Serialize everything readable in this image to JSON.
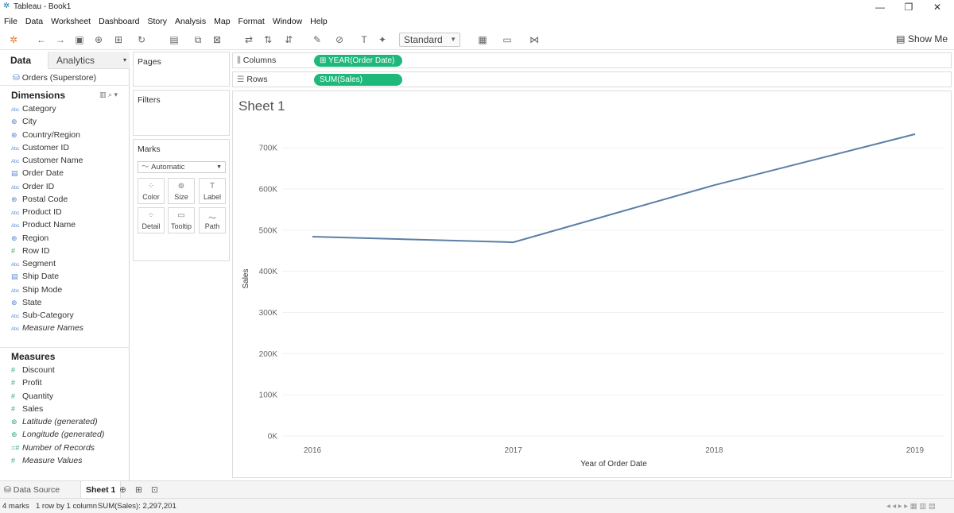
{
  "window": {
    "title": "Tableau - Book1"
  },
  "menu": [
    "File",
    "Data",
    "Worksheet",
    "Dashboard",
    "Story",
    "Analysis",
    "Map",
    "Format",
    "Window",
    "Help"
  ],
  "toolbar": {
    "view_mode": "Standard",
    "show_me": "Show Me"
  },
  "left_pane": {
    "tabs": {
      "data": "Data",
      "analytics": "Analytics"
    },
    "datasource": "Orders (Superstore)",
    "dimensions_header": "Dimensions",
    "dimensions": [
      {
        "icon": "Abc",
        "name": "Category"
      },
      {
        "icon": "globe",
        "name": "City"
      },
      {
        "icon": "globe",
        "name": "Country/Region"
      },
      {
        "icon": "Abc",
        "name": "Customer ID"
      },
      {
        "icon": "Abc",
        "name": "Customer Name"
      },
      {
        "icon": "date",
        "name": "Order Date"
      },
      {
        "icon": "Abc",
        "name": "Order ID"
      },
      {
        "icon": "globe",
        "name": "Postal Code"
      },
      {
        "icon": "Abc",
        "name": "Product ID"
      },
      {
        "icon": "Abc",
        "name": "Product Name"
      },
      {
        "icon": "globe",
        "name": "Region"
      },
      {
        "icon": "#",
        "name": "Row ID"
      },
      {
        "icon": "Abc",
        "name": "Segment"
      },
      {
        "icon": "date",
        "name": "Ship Date"
      },
      {
        "icon": "Abc",
        "name": "Ship Mode"
      },
      {
        "icon": "globe",
        "name": "State"
      },
      {
        "icon": "Abc",
        "name": "Sub-Category"
      },
      {
        "icon": "Abc",
        "name": "Measure Names"
      }
    ],
    "measures_header": "Measures",
    "measures": [
      {
        "icon": "#",
        "name": "Discount"
      },
      {
        "icon": "#",
        "name": "Profit"
      },
      {
        "icon": "#",
        "name": "Quantity"
      },
      {
        "icon": "#",
        "name": "Sales"
      },
      {
        "icon": "globe",
        "name": "Latitude (generated)"
      },
      {
        "icon": "globe",
        "name": "Longitude (generated)"
      },
      {
        "icon": "=#",
        "name": "Number of Records"
      },
      {
        "icon": "#",
        "name": "Measure Values"
      }
    ]
  },
  "cards": {
    "pages": "Pages",
    "filters": "Filters",
    "marks": "Marks",
    "mark_type": "Automatic",
    "mark_buttons": [
      "Color",
      "Size",
      "Label",
      "Detail",
      "Tooltip",
      "Path"
    ]
  },
  "shelves": {
    "columns_label": "Columns",
    "columns_pill": "YEAR(Order Date)",
    "rows_label": "Rows",
    "rows_pill": "SUM(Sales)"
  },
  "sheet_title": "Sheet 1",
  "chart_data": {
    "type": "line",
    "x": [
      "2016",
      "2017",
      "2018",
      "2019"
    ],
    "series": [
      {
        "values": [
          484247,
          470533,
          609206,
          733215
        ]
      }
    ],
    "xlabel": "Year of Order Date",
    "ylabel": "Sales",
    "ylim": [
      0,
      760000
    ],
    "yticks": [
      0,
      100000,
      200000,
      300000,
      400000,
      500000,
      600000,
      700000
    ],
    "ytick_labels": [
      "0K",
      "100K",
      "200K",
      "300K",
      "400K",
      "500K",
      "600K",
      "700K"
    ],
    "line_color": "#5b7fa6",
    "grid": true
  },
  "bottom_tabs": {
    "datasource": "Data Source",
    "sheet": "Sheet 1"
  },
  "status": {
    "marks": "4 marks",
    "rows_cols": "1 row by 1 column",
    "sum": "SUM(Sales): 2,297,201"
  }
}
